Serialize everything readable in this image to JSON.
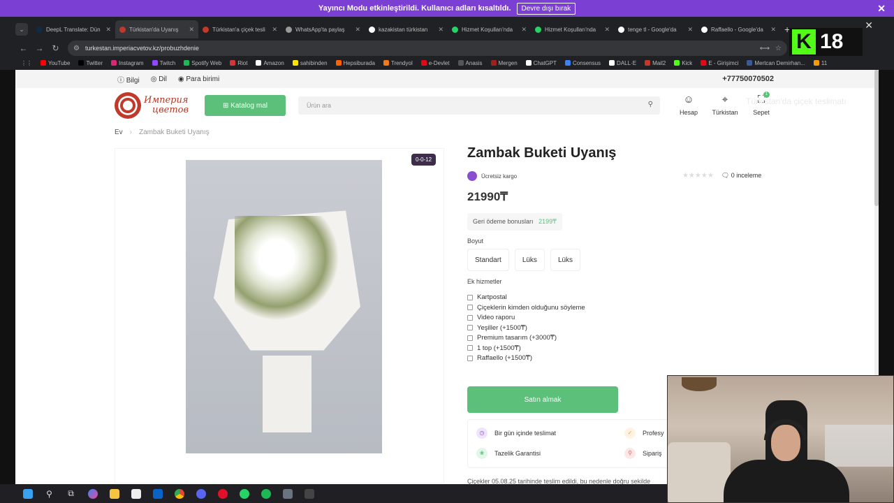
{
  "banner": {
    "text": "Yayıncı Modu etkinleştirildi. Kullanıcı adları kısaltıldı.",
    "button": "Devre dışı bırak"
  },
  "browser": {
    "tabs": [
      {
        "title": "DeepL Translate: Dün",
        "color": "#0f2b46",
        "active": false
      },
      {
        "title": "Türkistan'da Uyanış",
        "color": "#c0392b",
        "active": true
      },
      {
        "title": "Türkistan'a çiçek tesli",
        "color": "#c0392b",
        "active": false
      },
      {
        "title": "WhatsApp'ta paylaş",
        "color": "#999999",
        "active": false
      },
      {
        "title": "kazakistan türkistan",
        "color": "#ffffff",
        "active": false
      },
      {
        "title": "Hizmet Koşulları'nda",
        "color": "#25d366",
        "active": false
      },
      {
        "title": "Hizmet Koşulları'nda",
        "color": "#25d366",
        "active": false
      },
      {
        "title": "tenge tl - Google'da",
        "color": "#ffffff",
        "active": false
      },
      {
        "title": "Raffaello - Google'da",
        "color": "#ffffff",
        "active": false
      }
    ],
    "url": "turkestan.imperiacvetov.kz/probuzhdenie",
    "bookmarks": [
      {
        "label": "YouTube",
        "color": "#ff0000"
      },
      {
        "label": "Twitter",
        "color": "#000000"
      },
      {
        "label": "Instagram",
        "color": "#d62976"
      },
      {
        "label": "Twitch",
        "color": "#9146ff"
      },
      {
        "label": "Spotify Web",
        "color": "#1db954"
      },
      {
        "label": "Riot",
        "color": "#d13639"
      },
      {
        "label": "Amazon",
        "color": "#ffffff"
      },
      {
        "label": "sahibinden",
        "color": "#ffe800"
      },
      {
        "label": "Hepsiburada",
        "color": "#ff6000"
      },
      {
        "label": "Trendyol",
        "color": "#f27a1a"
      },
      {
        "label": "e-Devlet",
        "color": "#e30a17"
      },
      {
        "label": "Anasis",
        "color": "#555555"
      },
      {
        "label": "Mergen",
        "color": "#a02020"
      },
      {
        "label": "ChatGPT",
        "color": "#ffffff"
      },
      {
        "label": "Consensus",
        "color": "#3b82f6"
      },
      {
        "label": "DALL·E",
        "color": "#ffffff"
      },
      {
        "label": "Mail2",
        "color": "#c0392b"
      },
      {
        "label": "Kick",
        "color": "#53fc18"
      },
      {
        "label": "E - Girişimci",
        "color": "#e30a17"
      },
      {
        "label": "Mertcan Demirhan...",
        "color": "#3b5998"
      },
      {
        "label": "11",
        "color": "#f39c12"
      }
    ]
  },
  "overlay": {
    "kick_letter": "K",
    "count": "18"
  },
  "site": {
    "topbar": {
      "info": "Bilgi",
      "lang": "Dil",
      "currency": "Para birimi",
      "phone": "+77750070502"
    },
    "logo": {
      "line1": "Империя",
      "line2": "цветов"
    },
    "catalog_btn": "Katalog mal",
    "search_placeholder": "Ürün ara",
    "header_icons": {
      "account": "Hesap",
      "city": "Türkistan",
      "cart": "Sepet",
      "cart_count": "1"
    },
    "ghost_text": "Türkistan'da çiçek teslimatı",
    "breadcrumb": {
      "home": "Ev",
      "sep": "›",
      "current": "Zambak Buketi Uyanış"
    },
    "tag": "0-0-12",
    "product": {
      "title": "Zambak Buketi Uyanış",
      "shipping": "Ücretsiz kargo",
      "stars": "★★★★★",
      "reviews": "0 inceleme",
      "price": "21990₸",
      "bonus_label": "Geri ödeme bonusları",
      "bonus_value": "2199₸",
      "size_label": "Boyut",
      "sizes": [
        "Standart",
        "Lüks",
        "Lüks"
      ],
      "extras_label": "Ek hizmetler",
      "extras": [
        "Kartpostal",
        "Çiçeklerin kimden olduğunu söyleme",
        "Video raporu",
        "Yeşiller (+1500₸)",
        "Premium tasarım (+3000₸)",
        "1 top (+1500₸)",
        "Raffaello (+1500₸)"
      ],
      "buy": "Satın almak",
      "features": [
        "Bir gün içinde teslimat",
        "Tazelik Garantisi",
        "Profesy",
        "Sipariş"
      ],
      "note": "Çiçekler 05.08.25 tarihinde teslim edildi, bu nedenle doğru sekilde"
    }
  }
}
